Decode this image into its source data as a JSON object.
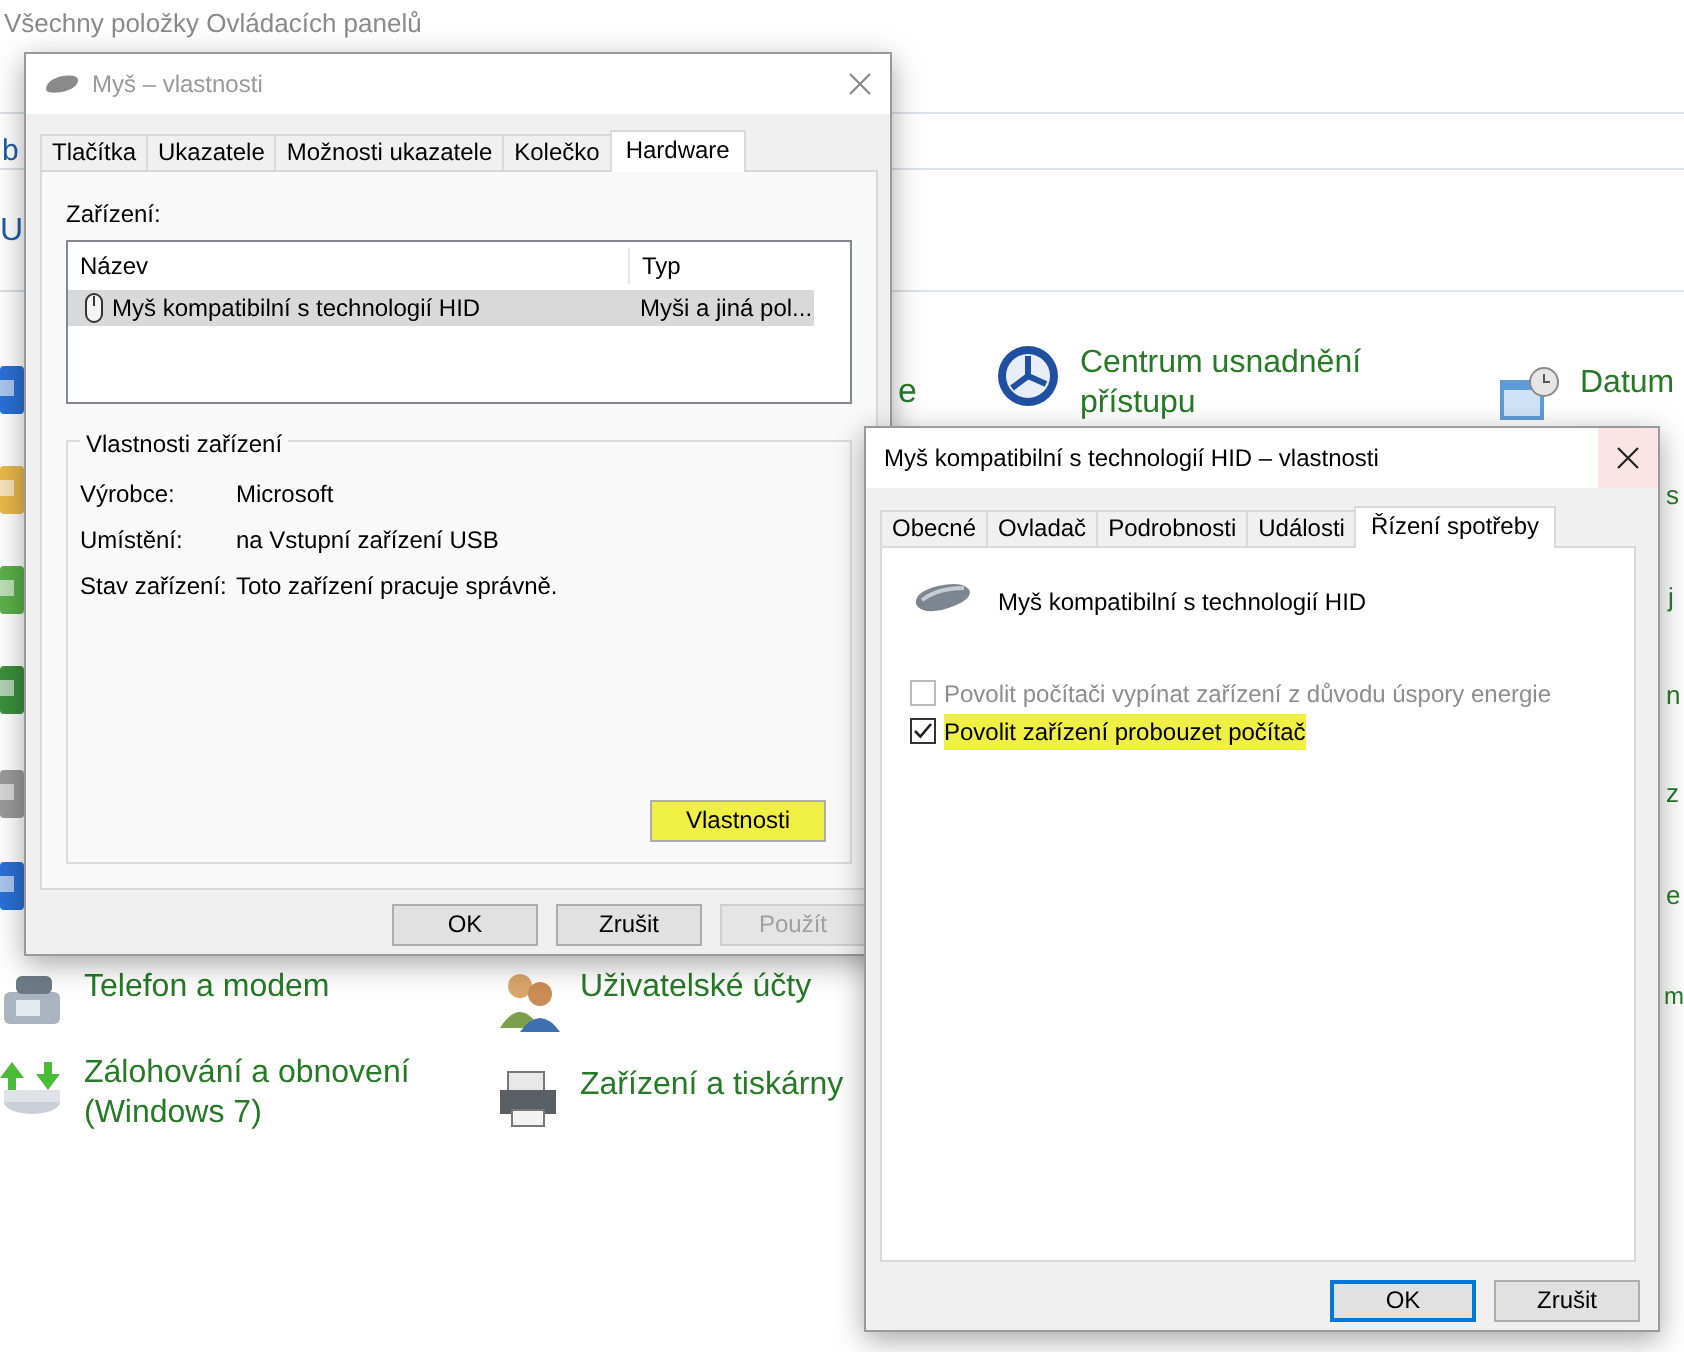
{
  "background": {
    "title": "Všechny položky Ovládacích panelů",
    "fragments": [
      "b",
      "U",
      "e",
      "s",
      "j",
      "n",
      "z",
      "e",
      "m"
    ],
    "edge_icons": [
      {
        "color": "#2a6fd6"
      },
      {
        "color": "#e8b84a"
      },
      {
        "color": "#5bb04a"
      },
      {
        "color": "#3c8f3c"
      },
      {
        "color": "#9a9a9a"
      },
      {
        "color": "#2a6fd6"
      }
    ],
    "items": [
      {
        "label": "Centrum usnadnění přístupu"
      },
      {
        "label": "Datum"
      },
      {
        "label": "Telefon a modem"
      },
      {
        "label": "Uživatelské účty"
      },
      {
        "label": "Zálohování a obnovení (Windows 7)"
      },
      {
        "label": "Zařízení a tiskárny"
      }
    ]
  },
  "mouse_dialog": {
    "title": "Myš – vlastnosti",
    "active": false,
    "tabs": [
      {
        "label": "Tlačítka",
        "selected": false
      },
      {
        "label": "Ukazatele",
        "selected": false
      },
      {
        "label": "Možnosti ukazatele",
        "selected": false
      },
      {
        "label": "Kolečko",
        "selected": false
      },
      {
        "label": "Hardware",
        "selected": true
      }
    ],
    "devices_label": "Zařízení:",
    "columns": [
      "Název",
      "Typ"
    ],
    "rows": [
      {
        "name": "Myš kompatibilní s technologií HID",
        "type": "Myši a jiná pol...",
        "selected": true
      }
    ],
    "group_title": "Vlastnosti zařízení",
    "properties": [
      {
        "label": "Výrobce:",
        "value": "Microsoft"
      },
      {
        "label": "Umístění:",
        "value": "na Vstupní zařízení USB"
      },
      {
        "label": "Stav zařízení:",
        "value": "Toto zařízení pracuje správně."
      }
    ],
    "properties_button": {
      "label": "Vlastnosti",
      "highlighted": true
    },
    "buttons": [
      {
        "label": "OK",
        "disabled": false
      },
      {
        "label": "Zrušit",
        "disabled": false
      },
      {
        "label": "Použít",
        "disabled": true
      }
    ]
  },
  "device_dialog": {
    "title": "Myš kompatibilní s technologií HID – vlastnosti",
    "active": true,
    "tabs": [
      {
        "label": "Obecné",
        "selected": false
      },
      {
        "label": "Ovladač",
        "selected": false
      },
      {
        "label": "Podrobnosti",
        "selected": false
      },
      {
        "label": "Události",
        "selected": false
      },
      {
        "label": "Řízení spotřeby",
        "selected": true
      }
    ],
    "device_name": "Myš kompatibilní s technologií HID",
    "options": [
      {
        "label": "Povolit počítači vypínat zařízení z důvodu úspory energie",
        "checked": false,
        "disabled": true,
        "highlighted": false
      },
      {
        "label": "Povolit zařízení probouzet počítač",
        "checked": true,
        "disabled": false,
        "highlighted": true
      }
    ],
    "buttons": [
      {
        "label": "OK",
        "default": true
      },
      {
        "label": "Zrušit",
        "default": false
      }
    ]
  }
}
